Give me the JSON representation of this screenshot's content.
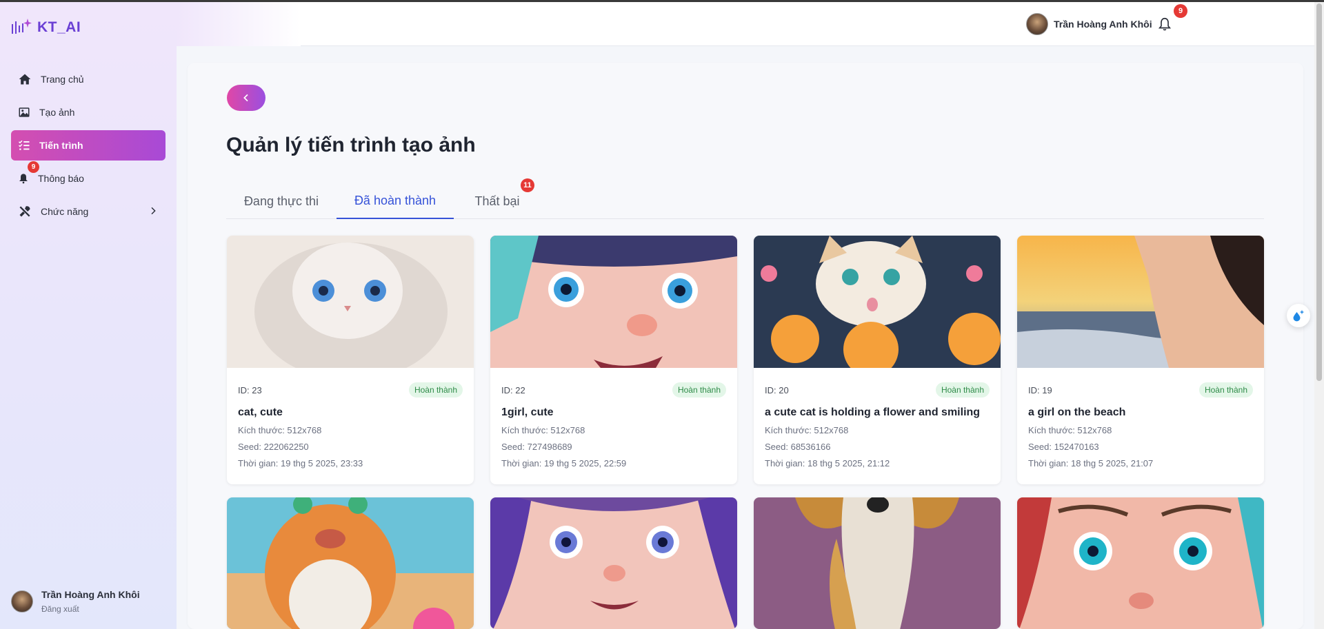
{
  "app": {
    "logo_text": "KT_AI"
  },
  "sidebar": {
    "items": [
      {
        "label": "Trang chủ"
      },
      {
        "label": "Tạo ảnh"
      },
      {
        "label": "Tiến trình"
      },
      {
        "label": "Thông báo",
        "badge": "9"
      },
      {
        "label": "Chức năng"
      }
    ],
    "user": {
      "name": "Trần Hoàng Anh Khôi",
      "logout": "Đăng xuất"
    }
  },
  "header": {
    "user_name": "Trần Hoàng Anh Khôi",
    "notification_count": "9"
  },
  "main": {
    "title": "Quản lý tiến trình tạo ảnh",
    "tabs": [
      {
        "label": "Đang thực thi"
      },
      {
        "label": "Đã hoàn thành"
      },
      {
        "label": "Thất bại",
        "badge": "11"
      }
    ],
    "active_tab": "Đã hoàn thành",
    "cards": [
      {
        "id": "ID: 23",
        "status": "Hoàn thành",
        "title": "cat, cute",
        "size": "Kích thước: 512x768",
        "seed": "Seed: 222062250",
        "time": "Thời gian: 19 thg 5 2025, 23:33"
      },
      {
        "id": "ID: 22",
        "status": "Hoàn thành",
        "title": "1girl, cute",
        "size": "Kích thước: 512x768",
        "seed": "Seed: 727498689",
        "time": "Thời gian: 19 thg 5 2025, 22:59"
      },
      {
        "id": "ID: 20",
        "status": "Hoàn thành",
        "title": "a cute cat is holding a flower and smiling",
        "size": "Kích thước: 512x768",
        "seed": "Seed: 68536166",
        "time": "Thời gian: 18 thg 5 2025, 21:12"
      },
      {
        "id": "ID: 19",
        "status": "Hoàn thành",
        "title": "a girl on the beach",
        "size": "Kích thước: 512x768",
        "seed": "Seed: 152470163",
        "time": "Thời gian: 18 thg 5 2025, 21:07"
      }
    ]
  },
  "colors": {
    "accent": "#3552d8",
    "active_nav_start": "#d44eb0",
    "active_nav_end": "#a84ad6",
    "badge_red": "#e53935",
    "status_green": "#2e8b48"
  }
}
